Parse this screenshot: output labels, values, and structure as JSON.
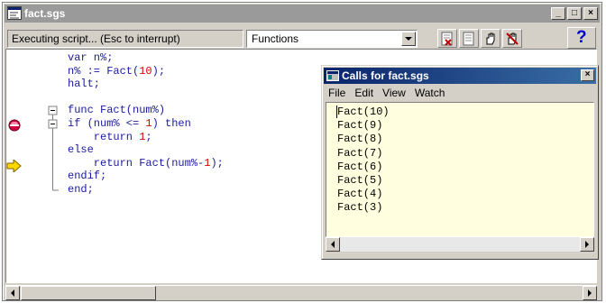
{
  "window": {
    "title": "fact.sgs",
    "minimize_glyph": "_",
    "maximize_glyph": "□",
    "close_glyph": "×"
  },
  "toolbar": {
    "status_text": "Executing script... (Esc to interrupt)",
    "functions_combo_value": "Functions",
    "buttons": [
      "clear-breakpoints-icon",
      "step-icon",
      "stop-hand-icon",
      "break-hand-icon",
      "help-icon"
    ],
    "help_glyph": "?"
  },
  "editor": {
    "lines": [
      "var n%;",
      "n% := Fact(10);",
      "halt;",
      "",
      "func Fact(num%)",
      "if (num% <= 1) then",
      "    return 1;",
      "else",
      "    return Fact(num%-1);",
      "endif;",
      "end;"
    ],
    "breakpoint_line": 6,
    "current_line": 9,
    "accent_code_color": "#1a1aa0",
    "number_color": "#d40000"
  },
  "calls_window": {
    "title": "Calls for fact.sgs",
    "close_glyph": "×",
    "menu": [
      "File",
      "Edit",
      "View",
      "Watch"
    ],
    "calls": [
      "Fact(10)",
      "Fact(9)",
      "Fact(8)",
      "Fact(7)",
      "Fact(6)",
      "Fact(5)",
      "Fact(4)",
      "Fact(3)"
    ]
  }
}
